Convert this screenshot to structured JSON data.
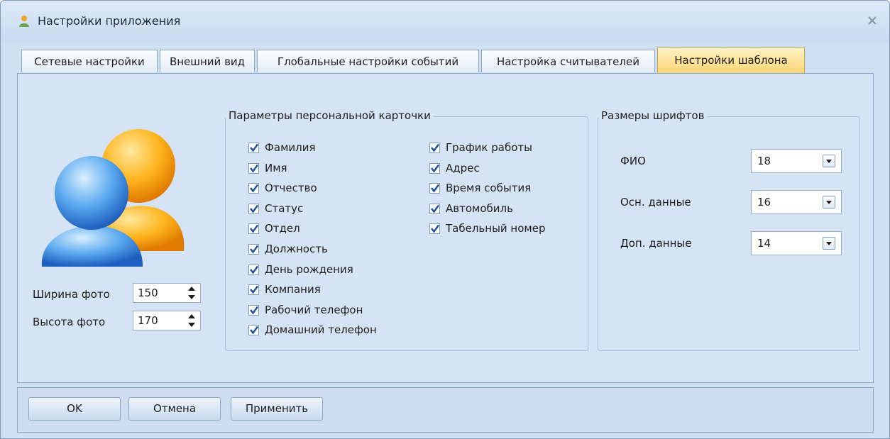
{
  "window": {
    "title": "Настройки приложения",
    "close_glyph": "x"
  },
  "tabs": [
    {
      "label": "Сетевые настройки",
      "active": false
    },
    {
      "label": "Внешний вид",
      "active": false
    },
    {
      "label": "Глобальные настройки событий",
      "active": false
    },
    {
      "label": "Настройка считывателей",
      "active": false
    },
    {
      "label": "Настройки шаблона",
      "active": true
    }
  ],
  "photo": {
    "icon": "users-icon",
    "width_label": "Ширина фото",
    "width_value": "150",
    "height_label": "Высота фото",
    "height_value": "170"
  },
  "card_params": {
    "legend": "Параметры персональной карточки",
    "left_column": [
      {
        "label": "Фамилия",
        "checked": true
      },
      {
        "label": "Имя",
        "checked": true
      },
      {
        "label": "Отчество",
        "checked": true
      },
      {
        "label": "Статус",
        "checked": true
      },
      {
        "label": "Отдел",
        "checked": true
      },
      {
        "label": "Должность",
        "checked": true
      },
      {
        "label": "День рождения",
        "checked": true
      },
      {
        "label": "Компания",
        "checked": true
      },
      {
        "label": "Рабочий телефон",
        "checked": true
      },
      {
        "label": "Домашний телефон",
        "checked": true
      }
    ],
    "right_column": [
      {
        "label": "График работы",
        "checked": true
      },
      {
        "label": "Адрес",
        "checked": true
      },
      {
        "label": "Время события",
        "checked": true
      },
      {
        "label": "Автомобиль",
        "checked": true
      },
      {
        "label": "Табельный  номер",
        "checked": true
      }
    ]
  },
  "font_sizes": {
    "legend": "Размеры шрифтов",
    "rows": [
      {
        "label": "ФИО",
        "value": "18"
      },
      {
        "label": "Осн. данные",
        "value": "16"
      },
      {
        "label": "Доп. данные",
        "value": "14"
      }
    ]
  },
  "buttons": {
    "ok": "OK",
    "cancel": "Отмена",
    "apply": "Применить"
  },
  "colors": {
    "window_bg": "#cfdff2",
    "active_tab": "#ffd576",
    "check": "#1f4f9e"
  }
}
